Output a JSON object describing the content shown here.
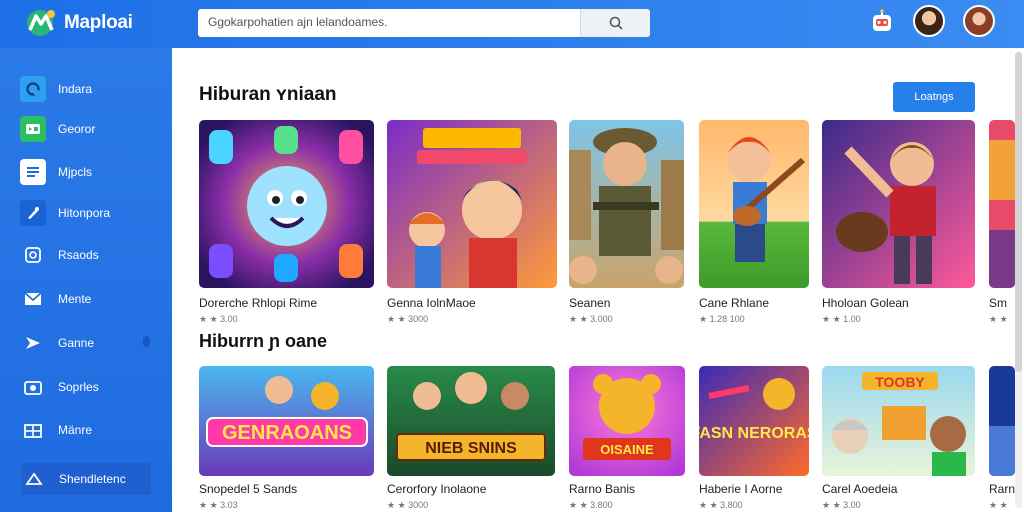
{
  "app": {
    "title": "Maploai"
  },
  "search": {
    "placeholder": "Ggokarpohatien ajn lelandoames."
  },
  "sidebar": {
    "items": [
      {
        "label": "Indara",
        "icon": "home-icon"
      },
      {
        "label": "Georor",
        "icon": "gamepad-icon"
      },
      {
        "label": "Mjpcls",
        "icon": "list-icon"
      },
      {
        "label": "Hitonpora",
        "icon": "music-icon"
      },
      {
        "label": "Rsaods",
        "icon": "refresh-icon"
      },
      {
        "label": "Mente",
        "icon": "mail-icon"
      },
      {
        "label": "Ganne",
        "icon": "play-icon"
      },
      {
        "label": "Soprles",
        "icon": "camera-icon"
      },
      {
        "label": "Mänre",
        "icon": "grid-icon"
      },
      {
        "label": "Shendletenc",
        "icon": "cloud-icon",
        "active": true
      }
    ]
  },
  "main": {
    "sections": [
      {
        "title": "Hiburan ʏniaan",
        "more_label": "Loatngs",
        "cards": [
          {
            "title": "Dorerche Rhlopi Rime",
            "rating": "★ ★ 3.00",
            "art": "jelly"
          },
          {
            "title": "Genna IolnMaoe",
            "rating": "★ ★ 3000",
            "art": "boy"
          },
          {
            "title": "Seanen",
            "rating": "★ ★ 3.000",
            "art": "soldier"
          },
          {
            "title": "Cane Rhlane",
            "rating": "★ 1.28 100",
            "art": "guitar"
          },
          {
            "title": "Hholoan Golean",
            "rating": "★ ★ 1.00",
            "art": "rock"
          },
          {
            "title": "Sm",
            "rating": "★ ★",
            "art": "partial"
          }
        ]
      },
      {
        "title": "Hiburrn ɲ oane",
        "cards": [
          {
            "title": "Snopedel 5 Sands",
            "rating": "★ ★ 3.03",
            "art": "genraoans",
            "banner": "GENRAOANS"
          },
          {
            "title": "Cerorfory Inolaone",
            "rating": "★ ★ 3000",
            "art": "team",
            "banner": "NIEB SNINS"
          },
          {
            "title": "Rarno Banis",
            "rating": "★ ★ 3.800",
            "art": "bear",
            "banner": "OISAINE"
          },
          {
            "title": "Haberie I Aorne",
            "rating": "★ ★ 3.800",
            "art": "fasn",
            "banner": "FASN NERORAS"
          },
          {
            "title": "Carel Aoedeia",
            "rating": "★ ★ 3.00",
            "art": "family",
            "banner": "TOOBY"
          },
          {
            "title": "Rarn",
            "rating": "★ ★",
            "art": "partial2"
          }
        ]
      }
    ]
  },
  "colors": {
    "brand": "#1d6fe6",
    "sidebar": "#2477e6",
    "button": "#2680ea"
  }
}
